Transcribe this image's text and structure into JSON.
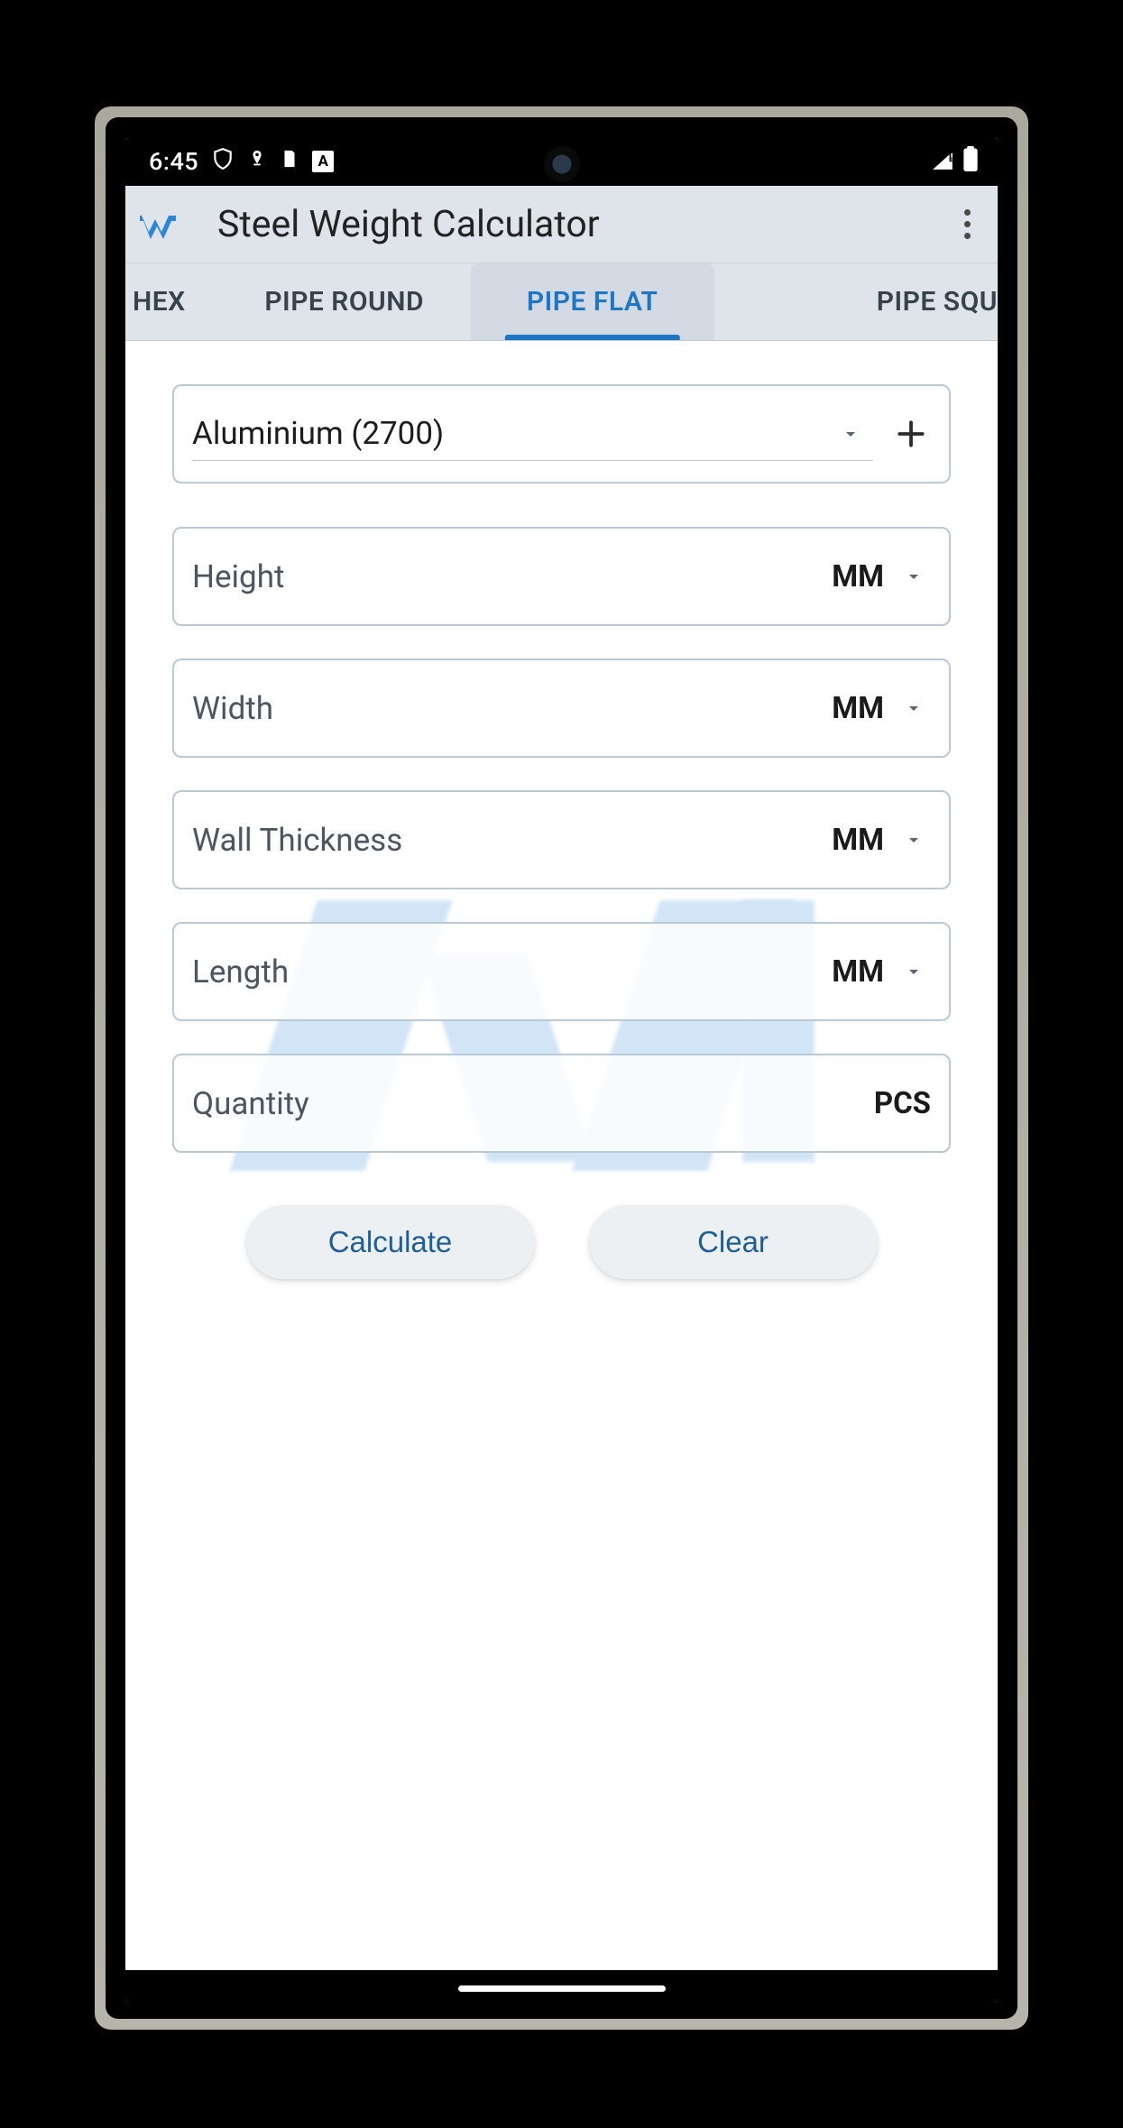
{
  "statusbar": {
    "time": "6:45"
  },
  "appbar": {
    "title": "Steel Weight Calculator"
  },
  "tabs": {
    "items": [
      {
        "label": "HEX",
        "active": false
      },
      {
        "label": "PIPE ROUND",
        "active": false
      },
      {
        "label": "PIPE FLAT",
        "active": true
      },
      {
        "label": "PIPE SQU",
        "active": false
      }
    ]
  },
  "material": {
    "selected": "Aluminium (2700)"
  },
  "fields": {
    "height": {
      "label": "Height",
      "unit": "MM"
    },
    "width": {
      "label": "Width",
      "unit": "MM"
    },
    "wall_thickness": {
      "label": "Wall Thickness",
      "unit": "MM"
    },
    "length": {
      "label": "Length",
      "unit": "MM"
    },
    "quantity": {
      "label": "Quantity",
      "unit": "PCS"
    }
  },
  "buttons": {
    "calculate": "Calculate",
    "clear": "Clear"
  }
}
